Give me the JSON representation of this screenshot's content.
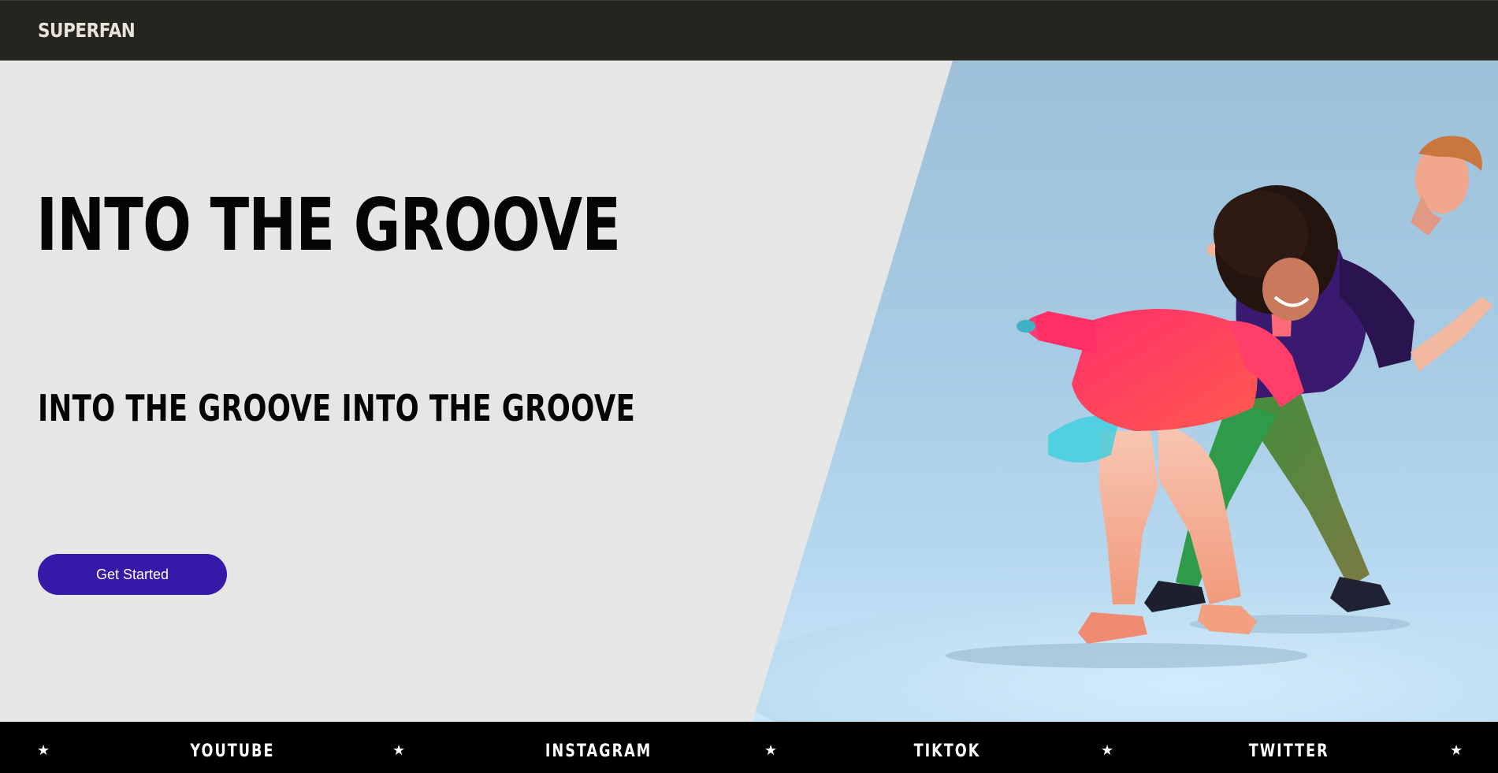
{
  "header": {
    "logo": "SUPERFAN"
  },
  "hero": {
    "title": "INTO THE GROOVE",
    "subtitle": "INTO THE GROOVE INTO THE GROOVE",
    "cta_label": "Get Started",
    "image_subject": "two dancers"
  },
  "social": {
    "separator_icon": "star-icon",
    "links": [
      {
        "label": "YOUTUBE"
      },
      {
        "label": "INSTAGRAM"
      },
      {
        "label": "TIKTOK"
      },
      {
        "label": "TWITTER"
      }
    ]
  },
  "colors": {
    "header_bg": "#252520",
    "hero_bg": "#e6e6e6",
    "cta_bg": "#3619a8",
    "ticker_bg": "#000000",
    "photo_backdrop": "#a7cbe4"
  }
}
